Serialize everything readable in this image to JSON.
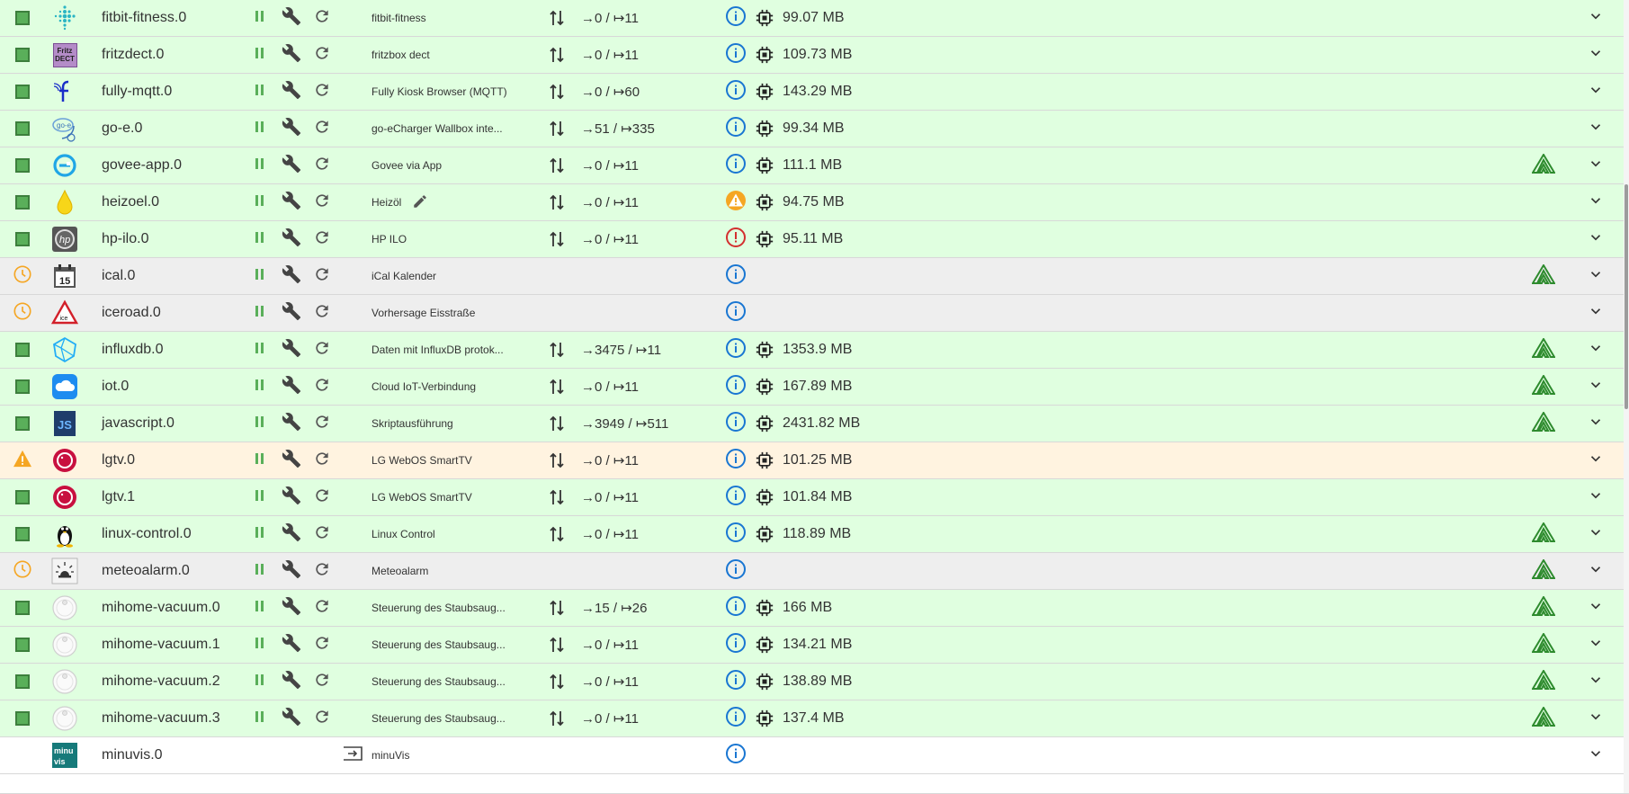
{
  "colors": {
    "running_bg": "#e0ffe0",
    "warning_bg": "#fff3e0",
    "scheduled_bg": "#eeeeee",
    "green": "#5aaf5a",
    "orange": "#f5a623",
    "info_blue": "#1976d2",
    "error_red": "#d32f2f",
    "sentry_green": "#2e8b2e"
  },
  "rows": [
    {
      "name": "fitbit-fitness.0",
      "title": "fitbit-fitness",
      "io_in": "→0",
      "io_out": "↦11",
      "memory": "99.07 MB",
      "state": "running",
      "info": "info",
      "sentry": false,
      "logo": "fitbit-logo",
      "logo_text": "",
      "edit": false
    },
    {
      "name": "fritzdect.0",
      "title": "fritzbox dect",
      "io_in": "→0",
      "io_out": "↦11",
      "memory": "109.73 MB",
      "state": "running",
      "info": "info",
      "sentry": false,
      "logo": "fritzdect-logo",
      "logo_text": "Fritz DECT",
      "edit": false
    },
    {
      "name": "fully-mqtt.0",
      "title": "Fully Kiosk Browser (MQTT)",
      "io_in": "→0",
      "io_out": "↦60",
      "memory": "143.29 MB",
      "state": "running",
      "info": "info",
      "sentry": false,
      "logo": "fully-logo",
      "logo_text": "",
      "edit": false
    },
    {
      "name": "go-e.0",
      "title": "go-eCharger Wallbox inte...",
      "io_in": "→51",
      "io_out": "↦335",
      "memory": "99.34 MB",
      "state": "running",
      "info": "info",
      "sentry": false,
      "logo": "go-e-logo",
      "logo_text": "",
      "edit": false
    },
    {
      "name": "govee-app.0",
      "title": "Govee via App",
      "io_in": "→0",
      "io_out": "↦11",
      "memory": "111.1 MB",
      "state": "running",
      "info": "info",
      "sentry": true,
      "logo": "govee-logo",
      "logo_text": "",
      "edit": false
    },
    {
      "name": "heizoel.0",
      "title": "Heizöl",
      "io_in": "→0",
      "io_out": "↦11",
      "memory": "94.75 MB",
      "state": "running",
      "info": "warning",
      "sentry": false,
      "logo": "oil-drop-logo",
      "logo_text": "",
      "edit": true
    },
    {
      "name": "hp-ilo.0",
      "title": "HP ILO",
      "io_in": "→0",
      "io_out": "↦11",
      "memory": "95.11 MB",
      "state": "running",
      "info": "error",
      "sentry": false,
      "logo": "hp-logo",
      "logo_text": "",
      "edit": false
    },
    {
      "name": "ical.0",
      "title": "iCal Kalender",
      "io_in": "",
      "io_out": "",
      "memory": "",
      "state": "scheduled",
      "info": "info",
      "sentry": true,
      "logo": "calendar-logo",
      "logo_text": "15",
      "edit": false
    },
    {
      "name": "iceroad.0",
      "title": "Vorhersage Eisstraße",
      "io_in": "",
      "io_out": "",
      "memory": "",
      "state": "scheduled",
      "info": "info",
      "sentry": false,
      "logo": "ice-warning-logo",
      "logo_text": "ice",
      "edit": false
    },
    {
      "name": "influxdb.0",
      "title": "Daten mit InfluxDB protok...",
      "io_in": "→3475",
      "io_out": "↦11",
      "memory": "1353.9 MB",
      "state": "running",
      "info": "info",
      "sentry": true,
      "logo": "influxdb-logo",
      "logo_text": "",
      "edit": false
    },
    {
      "name": "iot.0",
      "title": "Cloud IoT-Verbindung",
      "io_in": "→0",
      "io_out": "↦11",
      "memory": "167.89 MB",
      "state": "running",
      "info": "info",
      "sentry": true,
      "logo": "cloud-logo",
      "logo_text": "",
      "edit": false
    },
    {
      "name": "javascript.0",
      "title": "Skriptausführung",
      "io_in": "→3949",
      "io_out": "↦511",
      "memory": "2431.82 MB",
      "state": "running",
      "info": "info",
      "sentry": true,
      "logo": "javascript-logo",
      "logo_text": "JS",
      "edit": false
    },
    {
      "name": "lgtv.0",
      "title": "LG WebOS SmartTV",
      "io_in": "→0",
      "io_out": "↦11",
      "memory": "101.25 MB",
      "state": "warning",
      "info": "info",
      "sentry": false,
      "logo": "lg-logo",
      "logo_text": "",
      "edit": false
    },
    {
      "name": "lgtv.1",
      "title": "LG WebOS SmartTV",
      "io_in": "→0",
      "io_out": "↦11",
      "memory": "101.84 MB",
      "state": "running",
      "info": "info",
      "sentry": false,
      "logo": "lg-logo",
      "logo_text": "",
      "edit": false
    },
    {
      "name": "linux-control.0",
      "title": "Linux Control",
      "io_in": "→0",
      "io_out": "↦11",
      "memory": "118.89 MB",
      "state": "running",
      "info": "info",
      "sentry": true,
      "logo": "tux-logo",
      "logo_text": "",
      "edit": false
    },
    {
      "name": "meteoalarm.0",
      "title": "Meteoalarm",
      "io_in": "",
      "io_out": "",
      "memory": "",
      "state": "scheduled",
      "info": "info",
      "sentry": true,
      "logo": "meteoalarm-logo",
      "logo_text": "",
      "edit": false
    },
    {
      "name": "mihome-vacuum.0",
      "title": "Steuerung des Staubsaug...",
      "io_in": "→15",
      "io_out": "↦26",
      "memory": "166 MB",
      "state": "running",
      "info": "info",
      "sentry": true,
      "logo": "vacuum-logo",
      "logo_text": "",
      "edit": false
    },
    {
      "name": "mihome-vacuum.1",
      "title": "Steuerung des Staubsaug...",
      "io_in": "→0",
      "io_out": "↦11",
      "memory": "134.21 MB",
      "state": "running",
      "info": "info",
      "sentry": true,
      "logo": "vacuum-logo",
      "logo_text": "",
      "edit": false
    },
    {
      "name": "mihome-vacuum.2",
      "title": "Steuerung des Staubsaug...",
      "io_in": "→0",
      "io_out": "↦11",
      "memory": "138.89 MB",
      "state": "running",
      "info": "info",
      "sentry": true,
      "logo": "vacuum-logo",
      "logo_text": "",
      "edit": false
    },
    {
      "name": "mihome-vacuum.3",
      "title": "Steuerung des Staubsaug...",
      "io_in": "→0",
      "io_out": "↦11",
      "memory": "137.4 MB",
      "state": "running",
      "info": "info",
      "sentry": true,
      "logo": "vacuum-logo",
      "logo_text": "",
      "edit": false
    },
    {
      "name": "minuvis.0",
      "title": "minuVis",
      "io_in": "",
      "io_out": "",
      "memory": "",
      "state": "none",
      "info": "info",
      "sentry": false,
      "logo": "minuvis-logo",
      "logo_text": "minu vis",
      "edit": false,
      "link": true
    }
  ]
}
